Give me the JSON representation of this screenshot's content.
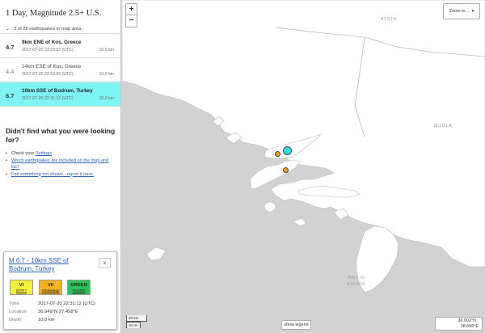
{
  "list": {
    "title": "1 Day, Magnitude 2.5+ U.S.",
    "summary": "3 of 28 earthquakes in map area.",
    "items": [
      {
        "mag": "4.7",
        "place": "9km ENE of Kos, Greece",
        "time": "2017-07-20 23:23:53 (UTC)",
        "depth": "10.0 km"
      },
      {
        "mag": "4.4",
        "place": "14km ESE of Kos, Greece",
        "time": "2017-07-20 22:52:59 (UTC)",
        "depth": "10.0 km"
      },
      {
        "mag": "6.7",
        "place": "10km SSE of Bodrum, Turkey",
        "time": "2017-07-20 22:31:12 (UTC)",
        "depth": "10.0 km"
      }
    ],
    "selected_color": "#7ff4f4"
  },
  "help": {
    "title": "Didn't find what you were looking for?",
    "check_prefix": "Check your ",
    "check_link": "Settings",
    "check_suffix": ".",
    "included_link": "Which earthquakes are included on the map and list?",
    "felt_link": "Felt something not shown - report it here."
  },
  "card": {
    "title": "M 6.7 - 10km SSE of Bodrum, Turkey",
    "close": "x",
    "badges": [
      {
        "top": "VI",
        "bottom": "DYFI?",
        "color": "#f2f23a"
      },
      {
        "top": "VII",
        "bottom": "ShakeMap",
        "color": "#f5b324"
      },
      {
        "top": "GREEN",
        "bottom": "PAGER",
        "color": "#2ec158"
      }
    ],
    "time_label": "Time",
    "time_value": "2017-07-20 22:31:12 (UTC)",
    "location_label": "Location",
    "location_value": "36.949°N 27.458°E",
    "depth_label": "Depth",
    "depth_value": "10.0 km"
  },
  "map": {
    "zoom_in": "+",
    "zoom_out": "−",
    "zoom_select": "Zoom to ...",
    "labels": {
      "aydin": "AYDIN",
      "mugla": "MUGLA",
      "notio": "NOTIO",
      "aigaio": "AIGAIO"
    },
    "scale_km": "20 km",
    "scale_mi": "10 mi",
    "show_legend": "show legend",
    "coord_lat": "36.002°N :",
    "coord_lon": "28.666°E",
    "colors": {
      "water": "#d2d2d2",
      "land": "#ffffff",
      "boundary": "#b9b9b9"
    }
  },
  "markers": [
    {
      "name": "quake-marker-m67",
      "mag": "6.7",
      "color": "#2fd9f0"
    },
    {
      "name": "quake-marker-m47",
      "mag": "4.7",
      "color": "#f29d1c"
    },
    {
      "name": "quake-marker-m44",
      "mag": "4.4",
      "color": "#f29d1c"
    }
  ]
}
